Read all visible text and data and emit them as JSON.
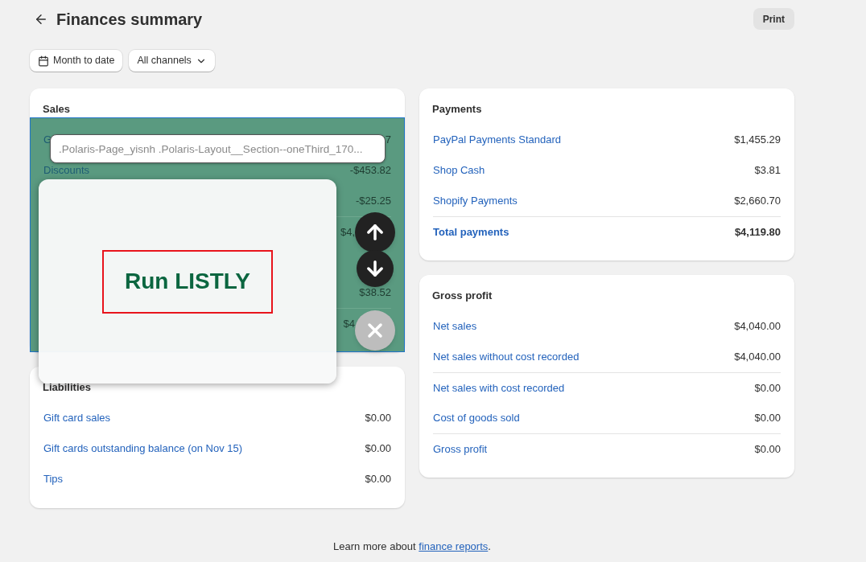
{
  "header": {
    "title": "Finances summary",
    "print_button": "Print"
  },
  "filters": [
    {
      "kind": "date",
      "label": "Month to date"
    },
    {
      "kind": "dropdown",
      "label": "All channels"
    }
  ],
  "sales": {
    "title": "Sales",
    "rows": [
      {
        "label": "G",
        "value": "7",
        "separated": false,
        "covered": false
      },
      {
        "label": "Discounts",
        "value": "-$453.82",
        "separated": false,
        "covered": false
      },
      {
        "value": "-$25.25",
        "separated": false,
        "covered": false
      },
      {
        "value": "$4,",
        "separated": true,
        "covered": true
      },
      {
        "separated": false
      },
      {
        "value": "$38.52",
        "separated": false,
        "covered": false
      },
      {
        "value": "$4",
        "separated": true,
        "covered": true
      }
    ]
  },
  "liabilities": {
    "title": "Liabilities",
    "rows": [
      {
        "label": "Gift card sales",
        "value": "$0.00",
        "separated": false,
        "bold": false
      },
      {
        "label": "Gift cards outstanding balance (on Nov 15)",
        "value": "$0.00",
        "separated": false,
        "bold": false
      },
      {
        "label": "Tips",
        "value": "$0.00",
        "separated": false,
        "bold": false
      }
    ]
  },
  "payments": {
    "title": "Payments",
    "rows": [
      {
        "label": "PayPal Payments Standard",
        "value": "$1,455.29",
        "separated": false,
        "bold": false
      },
      {
        "label": "Shop Cash",
        "value": "$3.81",
        "separated": false,
        "bold": false
      },
      {
        "label": "Shopify Payments",
        "value": "$2,660.70",
        "separated": false,
        "bold": false
      },
      {
        "label": "Total payments",
        "value": "$4,119.80",
        "separated": true,
        "bold": true
      }
    ]
  },
  "gross_profit": {
    "title": "Gross profit",
    "rows": [
      {
        "label": "Net sales",
        "value": "$4,040.00",
        "separated": false,
        "bold": false
      },
      {
        "label": "Net sales without cost recorded",
        "value": "$4,040.00",
        "separated": false,
        "bold": false
      },
      {
        "label": "Net sales with cost recorded",
        "value": "$0.00",
        "separated": true,
        "bold": false
      },
      {
        "label": "Cost of goods sold",
        "value": "$0.00",
        "separated": false,
        "bold": false
      },
      {
        "label": "Gross profit",
        "value": "$0.00",
        "separated": true,
        "bold": false
      }
    ]
  },
  "footer": {
    "text": "Learn more about ",
    "link": "finance reports",
    "end": "."
  },
  "overlay": {
    "selector_placeholder": ".Polaris-Page_yisnh .Polaris-Layout__Section--oneThird_170...",
    "run_button": "Run LISTLY"
  }
}
